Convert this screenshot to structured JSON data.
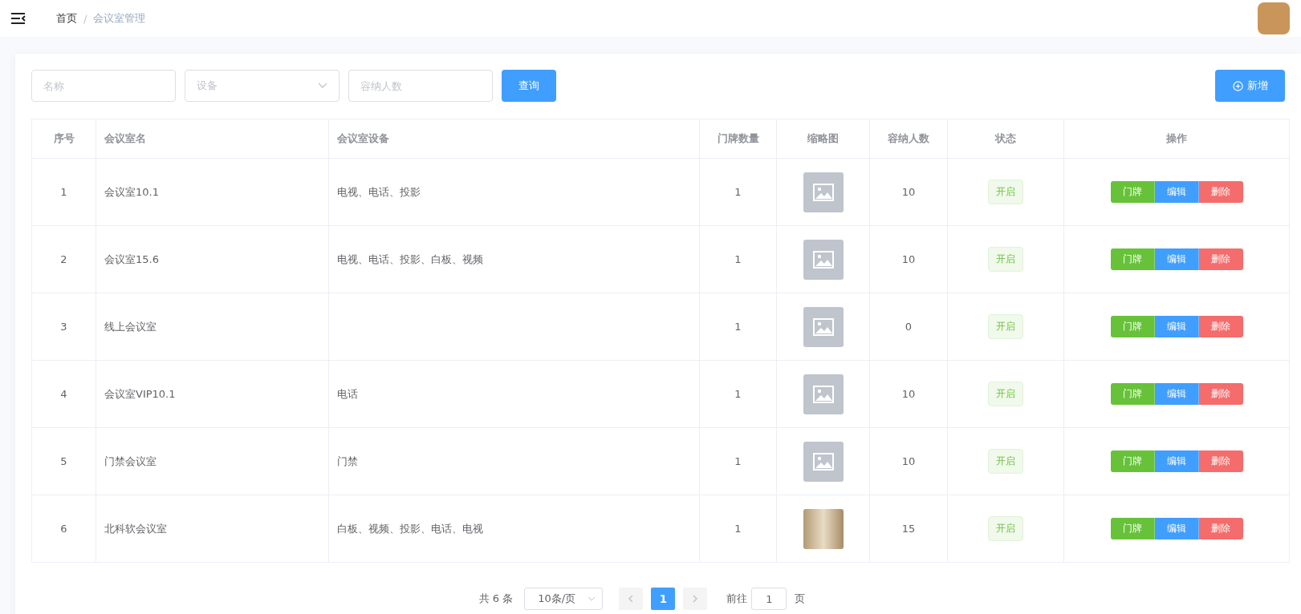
{
  "breadcrumb_separator": "/",
  "breadcrumb": [
    {
      "label": "首页",
      "selected": false
    },
    {
      "label": "会议室管理",
      "selected": true
    }
  ],
  "filters": {
    "name": {
      "placeholder": "名称"
    },
    "device": {
      "placeholder": "设备"
    },
    "capacity": {
      "placeholder": "容纳人数"
    },
    "query_button": "查询"
  },
  "add_button": "新增",
  "table": {
    "columns": [
      "序号",
      "会议室名",
      "会议室设备",
      "门牌数量",
      "缩略图",
      "容纳人数",
      "状态",
      "操作"
    ],
    "rows": [
      {
        "index": "1",
        "name": "会议室10.1",
        "devices": "电视、电话、投影",
        "plates": "1",
        "thumbnail": {
          "kind": "placeholder"
        },
        "capacity": "10",
        "status": "开启",
        "actions": [
          "门牌",
          "编辑",
          "删除"
        ]
      },
      {
        "index": "2",
        "name": "会议室15.6",
        "devices": "电视、电话、投影、白板、视频",
        "plates": "1",
        "thumbnail": {
          "kind": "placeholder"
        },
        "capacity": "10",
        "status": "开启",
        "actions": [
          "门牌",
          "编辑",
          "删除"
        ]
      },
      {
        "index": "3",
        "name": "线上会议室",
        "devices": "",
        "plates": "1",
        "thumbnail": {
          "kind": "placeholder"
        },
        "capacity": "0",
        "status": "开启",
        "actions": [
          "门牌",
          "编辑",
          "删除"
        ]
      },
      {
        "index": "4",
        "name": "会议室VIP10.1",
        "devices": "电话",
        "plates": "1",
        "thumbnail": {
          "kind": "placeholder"
        },
        "capacity": "10",
        "status": "开启",
        "actions": [
          "门牌",
          "编辑",
          "删除"
        ]
      },
      {
        "index": "5",
        "name": "门禁会议室",
        "devices": "门禁",
        "plates": "1",
        "thumbnail": {
          "kind": "placeholder"
        },
        "capacity": "10",
        "status": "开启",
        "actions": [
          "门牌",
          "编辑",
          "删除"
        ]
      },
      {
        "index": "6",
        "name": "北科软会议室",
        "devices": "白板、视频、投影、电话、电视",
        "plates": "1",
        "thumbnail": {
          "kind": "photo"
        },
        "capacity": "15",
        "status": "开启",
        "actions": [
          "门牌",
          "编辑",
          "删除"
        ]
      }
    ]
  },
  "pagination": {
    "total": "共 6 条",
    "page_size": "10条/页",
    "pages": [
      {
        "label": "1",
        "selected": true
      }
    ],
    "goto_label": "前往",
    "goto_value": "1",
    "goto_suffix": "页"
  }
}
